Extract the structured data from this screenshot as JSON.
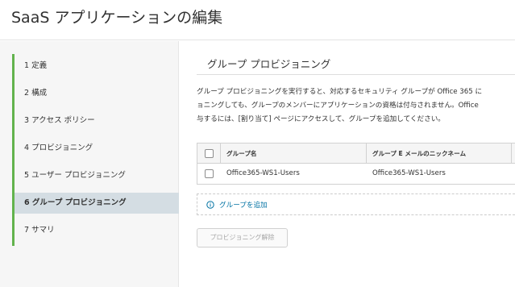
{
  "header": {
    "title": "SaaS アプリケーションの編集"
  },
  "sidebar": {
    "steps": [
      {
        "label": "1 定義"
      },
      {
        "label": "2 構成"
      },
      {
        "label": "3 アクセス ポリシー"
      },
      {
        "label": "4 プロビジョニング"
      },
      {
        "label": "5 ユーザー プロビジョニング"
      },
      {
        "label": "6 グループ プロビジョニング",
        "active": true
      },
      {
        "label": "7 サマリ"
      }
    ]
  },
  "main": {
    "section_title": "グループ プロビジョニング",
    "description_lines": [
      "グループ プロビジョニングを実行すると、対応するセキュリティ グループが Office 365 に",
      "ョニングしても、グループのメンバーにアプリケーションの資格は付与されません。Office",
      "与するには、[割り当て] ページにアクセスして、グループを追加してください。"
    ],
    "table": {
      "columns": [
        "グループ名",
        "グループ E メールのニックネーム"
      ],
      "rows": [
        [
          "Office365-WS1-Users",
          "Office365-WS1-Users"
        ]
      ]
    },
    "add_group_label": "グループを追加",
    "deprovision_label": "プロビジョニング解除"
  },
  "colors": {
    "accent_green": "#62b34d",
    "link_blue": "#0072a3",
    "active_step_bg": "#d4dde3"
  }
}
